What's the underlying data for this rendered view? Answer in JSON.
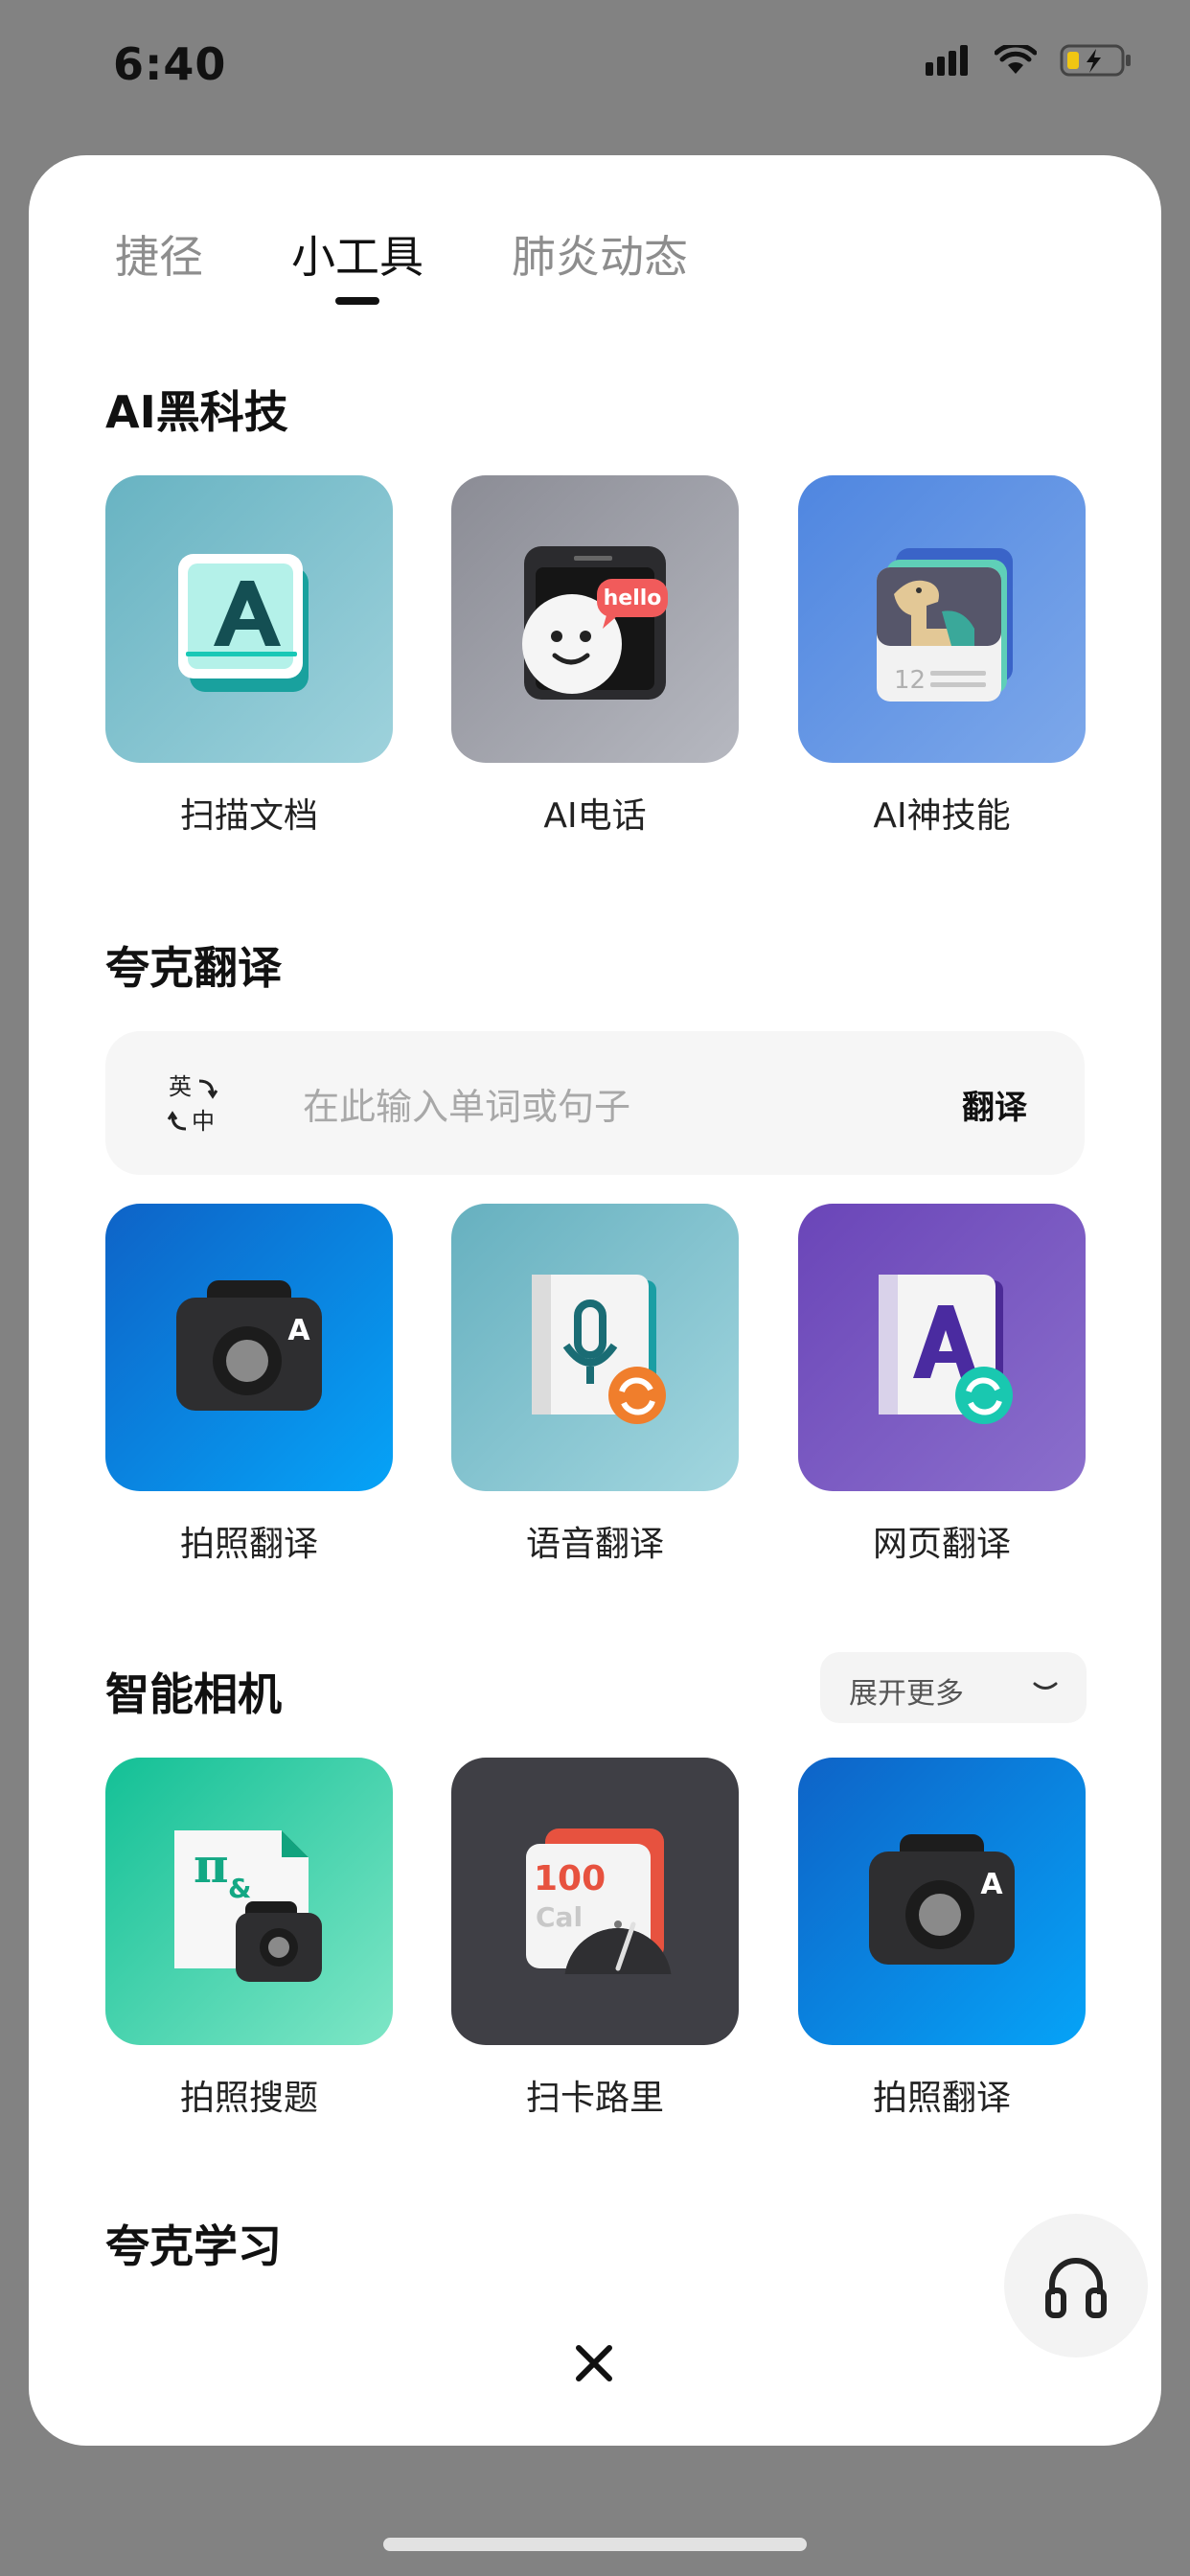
{
  "status_bar": {
    "time": "6:40"
  },
  "tabs": [
    {
      "label": "捷径",
      "active": false
    },
    {
      "label": "小工具",
      "active": true
    },
    {
      "label": "肺炎动态",
      "active": false
    }
  ],
  "sections": {
    "ai": {
      "title": "AI黑科技",
      "tiles": [
        {
          "label": "扫描文档",
          "icon": "scan-document-icon"
        },
        {
          "label": "AI电话",
          "icon": "ai-phone-icon",
          "badge": "hello"
        },
        {
          "label": "AI神技能",
          "icon": "ai-skills-icon",
          "badge_number": "12"
        }
      ]
    },
    "translate": {
      "title": "夸克翻译",
      "input": {
        "lang_top": "英",
        "lang_bottom": "中",
        "placeholder": "在此输入单词或句子",
        "button": "翻译"
      },
      "tiles": [
        {
          "label": "拍照翻译",
          "icon": "camera-translate-icon",
          "badge": "A"
        },
        {
          "label": "语音翻译",
          "icon": "voice-translate-icon"
        },
        {
          "label": "网页翻译",
          "icon": "web-translate-icon",
          "badge": "A"
        }
      ]
    },
    "camera": {
      "title": "智能相机",
      "expand_label": "展开更多",
      "tiles": [
        {
          "label": "拍照搜题",
          "icon": "photo-search-question-icon",
          "glyph_top": "π",
          "glyph_small": "&"
        },
        {
          "label": "扫卡路里",
          "icon": "scan-calorie-icon",
          "number": "100",
          "unit": "Cal"
        },
        {
          "label": "拍照翻译",
          "icon": "camera-translate-icon",
          "badge": "A"
        }
      ]
    },
    "study": {
      "title": "夸克学习"
    }
  },
  "colors": {
    "tab_active": "#111111",
    "tab_inactive": "#8d8d8d",
    "translate_bg": "#f6f6f6",
    "calorie_red": "#e7523f"
  }
}
